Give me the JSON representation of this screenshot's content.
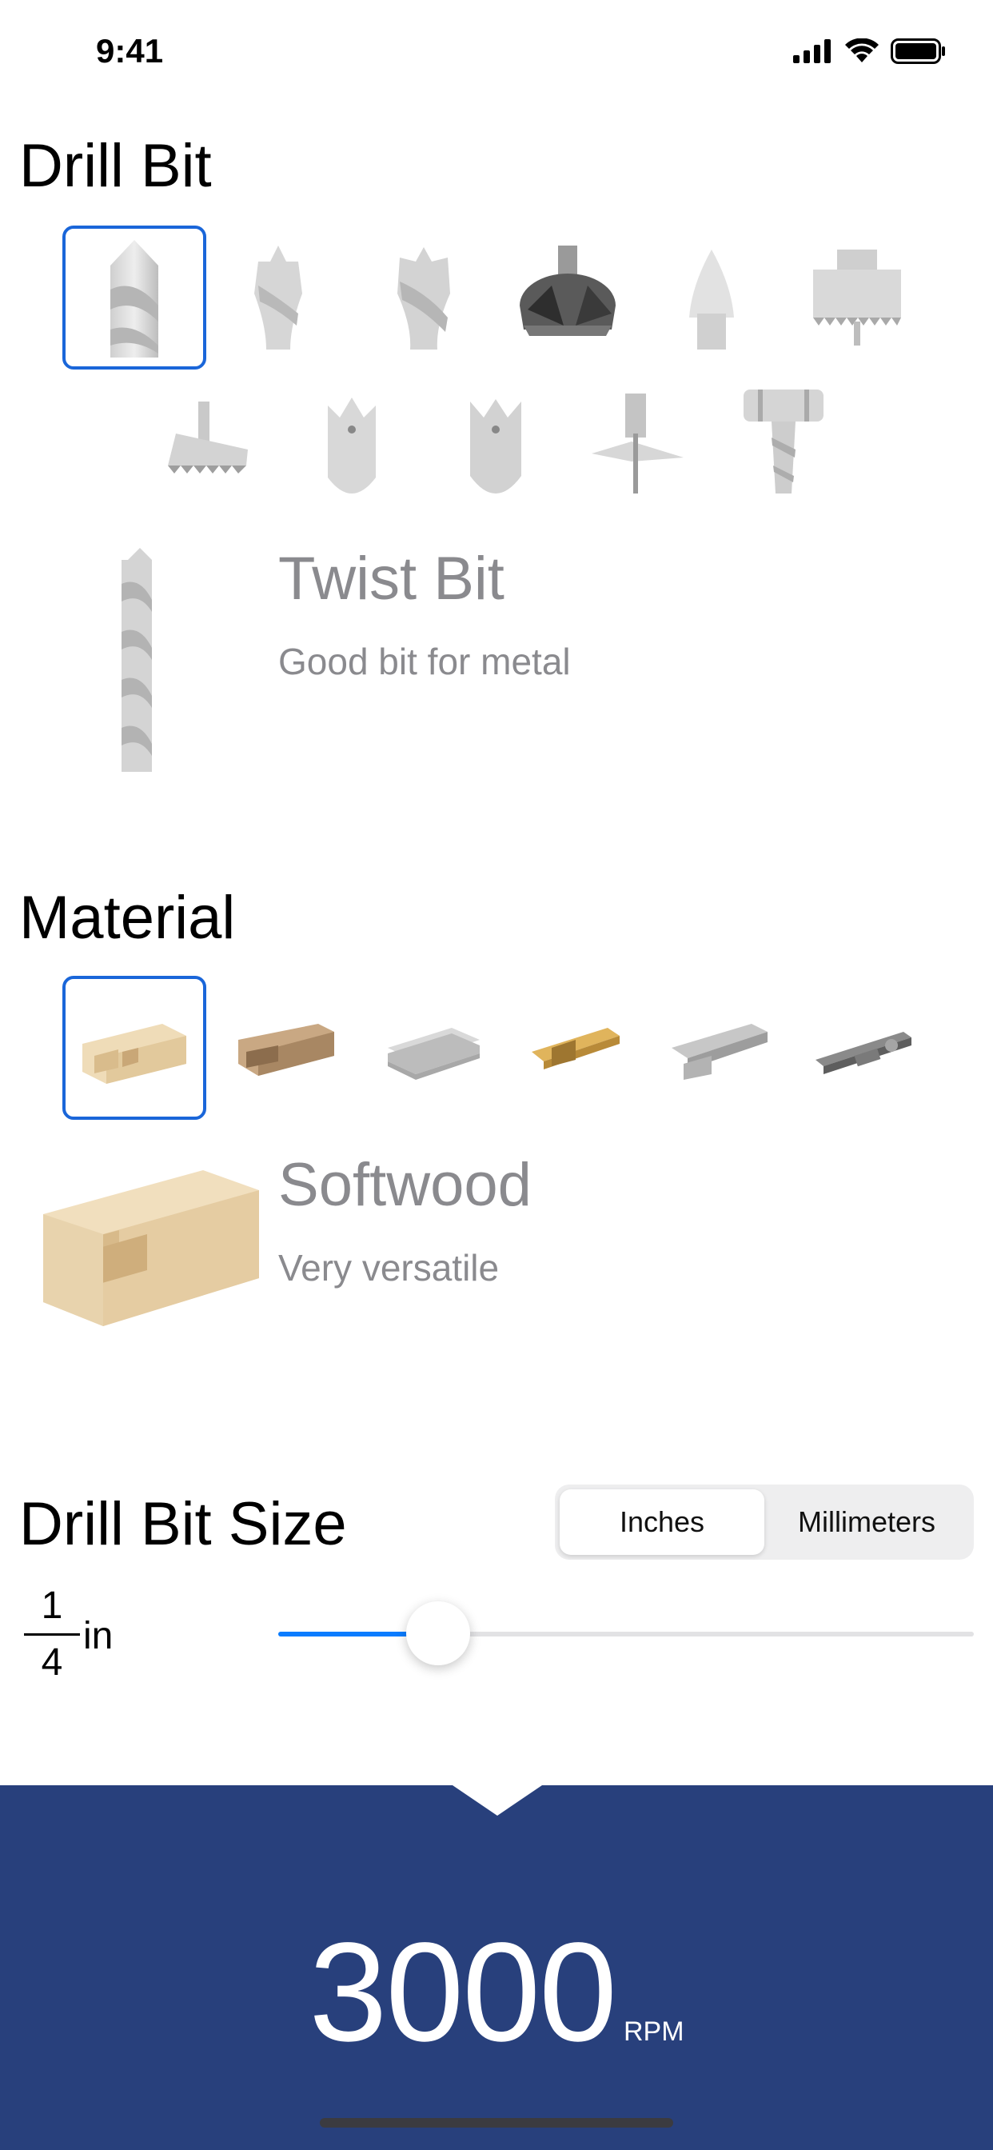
{
  "status_bar": {
    "time": "9:41",
    "icons": [
      "signal-icon",
      "wifi-icon",
      "battery-icon"
    ]
  },
  "drill_bit": {
    "title": "Drill Bit",
    "bits": [
      {
        "icon": "twist-bit-icon"
      },
      {
        "icon": "brad-point-bit-icon"
      },
      {
        "icon": "spur-bit-icon"
      },
      {
        "icon": "forstner-bit-icon"
      },
      {
        "icon": "countersink-bit-icon"
      },
      {
        "icon": "hole-saw-icon"
      },
      {
        "icon": "auger-bit-icon"
      },
      {
        "icon": "spade-bit-icon"
      },
      {
        "icon": "spade-bit-alt-icon"
      },
      {
        "icon": "fly-cutter-icon"
      },
      {
        "icon": "step-drill-icon"
      }
    ],
    "selected_index": 0,
    "selected_name": "Twist Bit",
    "selected_description": "Good bit for metal"
  },
  "material": {
    "title": "Material",
    "items": [
      {
        "icon": "softwood-icon"
      },
      {
        "icon": "hardwood-icon"
      },
      {
        "icon": "sheet-metal-icon"
      },
      {
        "icon": "brass-icon"
      },
      {
        "icon": "aluminum-icon"
      },
      {
        "icon": "steel-icon"
      }
    ],
    "selected_index": 0,
    "selected_name": "Softwood",
    "selected_description": "Very versatile"
  },
  "size": {
    "title": "Drill Bit Size",
    "segments": [
      "Inches",
      "Millimeters"
    ],
    "active_segment": "Inches",
    "fraction_numerator": "1",
    "fraction_denominator": "4",
    "unit": "in",
    "slider_fraction": 0.23
  },
  "result": {
    "value": "3000",
    "unit": "RPM"
  },
  "colors": {
    "accent": "#1a66d9",
    "slider": "#0a7cff",
    "panel": "#28407c"
  }
}
